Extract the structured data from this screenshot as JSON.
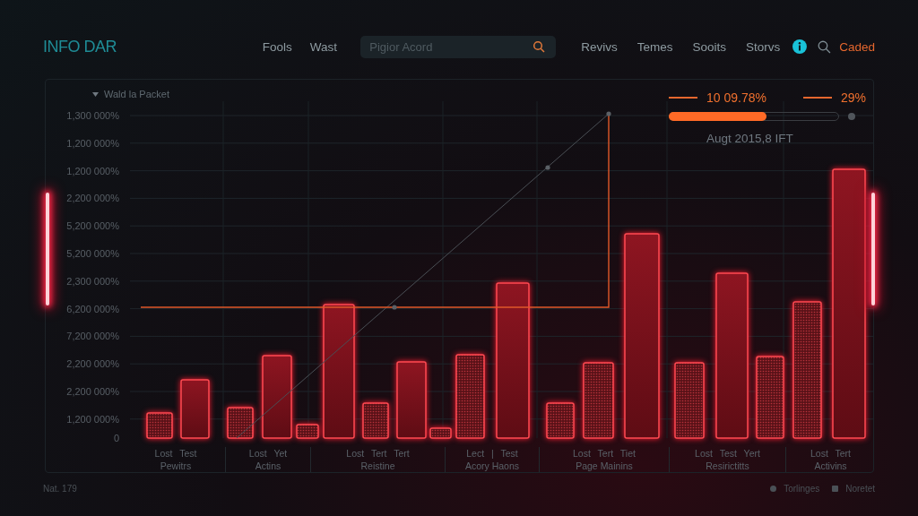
{
  "header": {
    "logo": "INFO DAR",
    "nav_left": [
      "Fools",
      "Wast"
    ],
    "search": {
      "placeholder": "Pigior Acord"
    },
    "nav_right": [
      "Revivs",
      "Temes",
      "Sooits",
      "Storvs"
    ],
    "action": "Caded"
  },
  "chart": {
    "legend": "Wald la Packet",
    "y_labels": [
      "1,300 000%",
      "1,200 000%",
      "1,200 000%",
      "2,200 000%",
      "5,200 000%",
      "5,200 000%",
      "2,300 000%",
      "6,200 000%",
      "7,200 000%",
      "2,200 000%",
      "2,200 000%",
      "1,200 000%",
      "0"
    ],
    "readouts": [
      "10 09.78%",
      "29%"
    ],
    "progress": {
      "level": 0.57
    },
    "date": "Augt 2015,8 IFT",
    "groups": [
      {
        "top": "Lost Test",
        "bottom": "Pewitrs"
      },
      {
        "top": "Lost Yet",
        "bottom": "Actins"
      },
      {
        "top": "Lost Tert Tert",
        "bottom": "Reistine"
      },
      {
        "top": "Lect | Test",
        "bottom": "Acory Haons"
      },
      {
        "top": "Lost Tert Tiet",
        "bottom": "Page Mainins"
      },
      {
        "top": "Lost Test Yert",
        "bottom": "Resirictitts"
      },
      {
        "top": "Lost Tert",
        "bottom": "Activins"
      }
    ]
  },
  "footer": {
    "left": "Nat. 179",
    "links": [
      "Torlinges",
      "Noretet"
    ]
  }
}
